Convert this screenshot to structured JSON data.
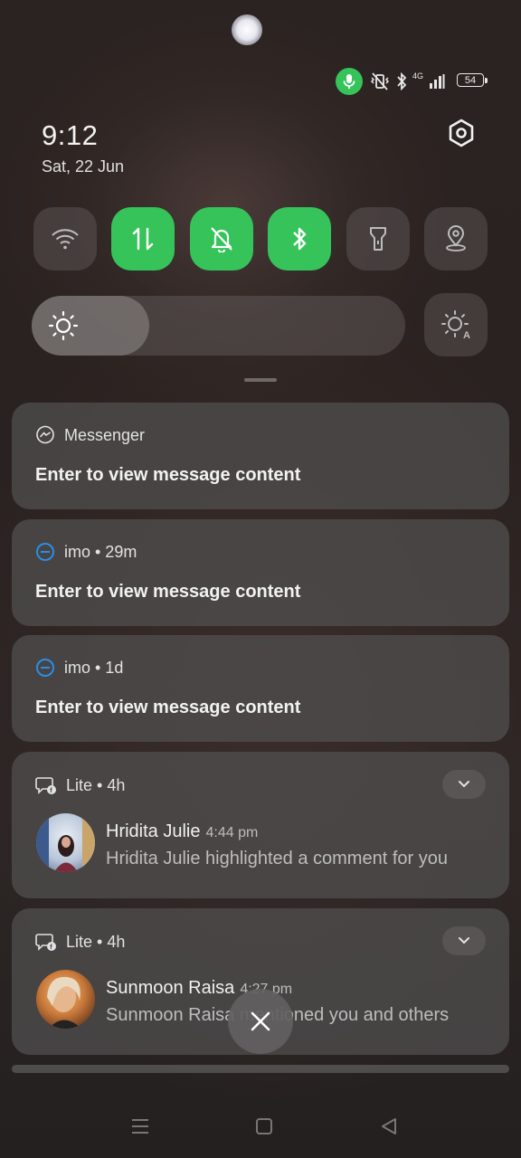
{
  "status_bar": {
    "battery": "54",
    "signal_text": "4G"
  },
  "panel": {
    "time": "9:12",
    "date": "Sat, 22 Jun"
  },
  "quick_tiles": [
    {
      "name": "wifi",
      "on": false
    },
    {
      "name": "mobile-data",
      "on": true
    },
    {
      "name": "silent",
      "on": true
    },
    {
      "name": "bluetooth",
      "on": true
    },
    {
      "name": "flashlight",
      "on": false
    },
    {
      "name": "location",
      "on": false
    }
  ],
  "brightness": {
    "level": 0.24
  },
  "notifications": [
    {
      "app": "Messenger",
      "body": "Enter to view message content"
    },
    {
      "app": "imo • 29m",
      "body": "Enter to view message content"
    },
    {
      "app": "imo • 1d",
      "body": "Enter to view message content"
    },
    {
      "app": "Lite • 4h",
      "sender": "Hridita Julie",
      "time": "4:44 pm",
      "text": "Hridita Julie highlighted a comment for you"
    },
    {
      "app": "Lite • 4h",
      "sender": "Sunmoon Raisa",
      "time": "4:27 pm",
      "text": "Sunmoon Raisa mentioned you and others"
    }
  ],
  "colors": {
    "accent_green": "#35c35a",
    "imo_blue": "#2a8ee8"
  }
}
